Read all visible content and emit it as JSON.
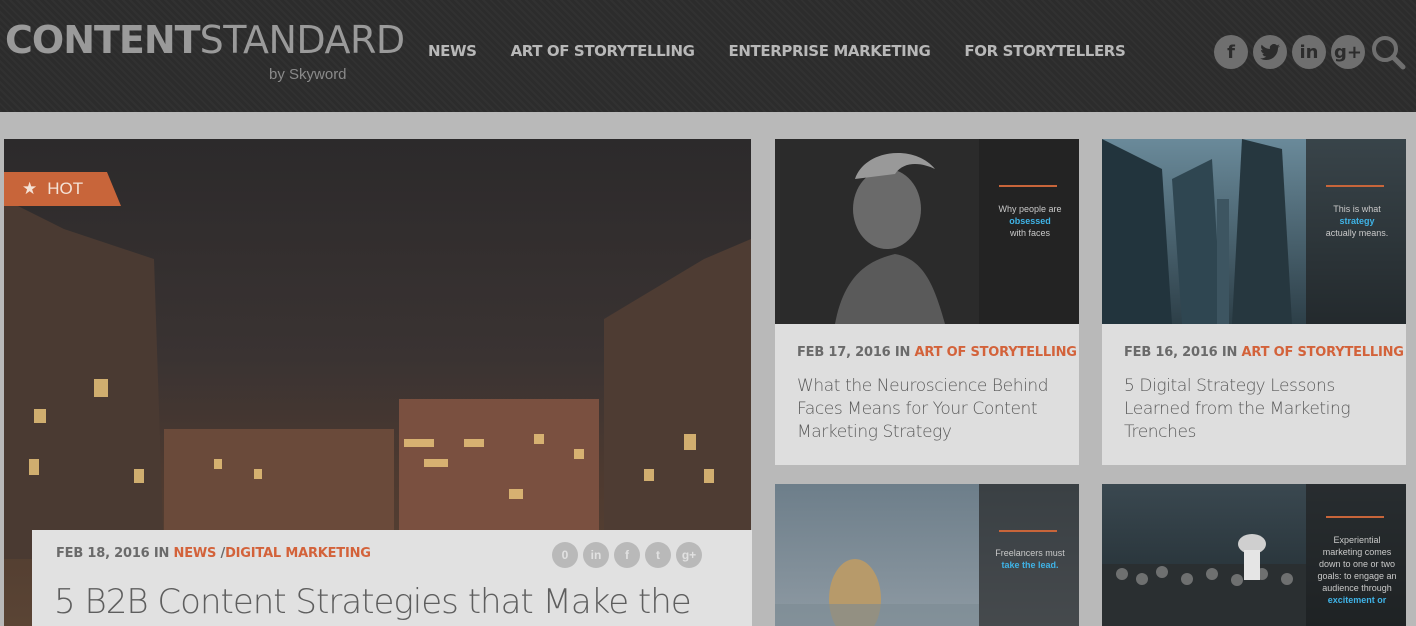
{
  "logo": {
    "bold": "CONTENT",
    "light": "STANDARD",
    "by": "by Skyword"
  },
  "nav": [
    "NEWS",
    "ART OF STORYTELLING",
    "ENTERPRISE MARKETING",
    "FOR STORYTELLERS"
  ],
  "social": {
    "facebook": "f",
    "twitter": "t",
    "linkedin": "in",
    "googleplus": "g+"
  },
  "hero": {
    "badge": "HOT",
    "date": "FEB 18, 2016 IN",
    "category1": "NEWS",
    "separator": "/",
    "category2": "DIGITAL MARKETING",
    "comment_count": "0",
    "share_icons": {
      "linkedin": "in",
      "facebook": "f",
      "twitter": "t",
      "googleplus": "g+"
    },
    "title": "5 B2B Content Strategies that Make the"
  },
  "cards": [
    {
      "date": "FEB 17, 2016 IN",
      "category": "ART OF STORYTELLING",
      "title": "What the Neuroscience Behind Faces Means for Your Content Marketing Strategy",
      "overlay_pre": "Why people are",
      "overlay_hl": "obsessed",
      "overlay_post": "with faces"
    },
    {
      "date": "FEB 16, 2016 IN",
      "category": "ART OF STORYTELLING",
      "title": "5 Digital Strategy Lessons Learned from the Marketing Trenches",
      "overlay_pre": "This is what",
      "overlay_hl": "strategy",
      "overlay_post": "actually means."
    },
    {
      "overlay_pre": "Freelancers must",
      "overlay_hl": "take the lead."
    },
    {
      "overlay_pre": "Experiential marketing comes down to one or two goals: to engage an audience through",
      "overlay_hl": "excitement or"
    }
  ],
  "colors": {
    "accent": "#d3623a",
    "header_bg": "#2c2c2c",
    "highlight": "#3fb3e6"
  }
}
